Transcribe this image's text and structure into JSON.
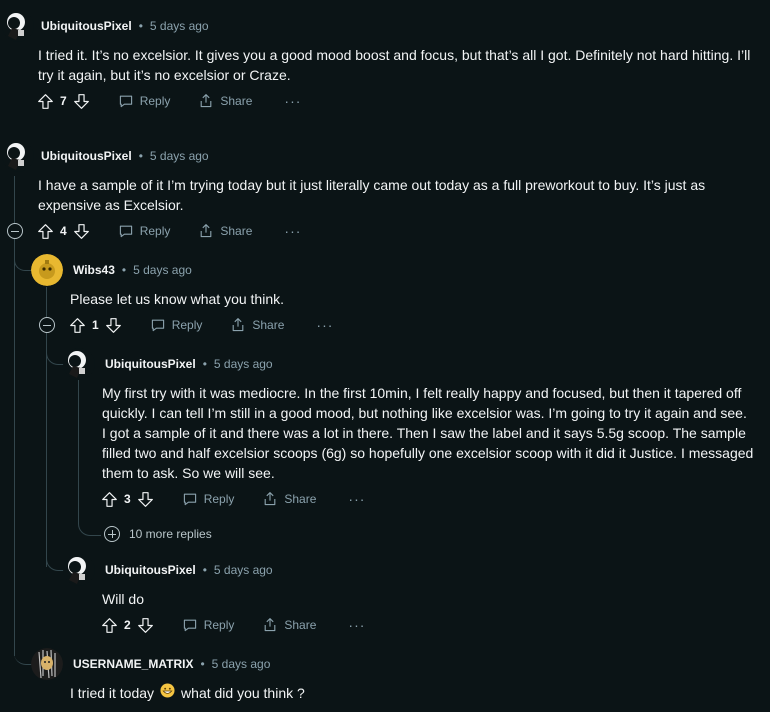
{
  "comments": [
    {
      "author": "UbiquitousPixel",
      "time": "5 days ago",
      "body": "I tried it. It’s no excelsior. It gives you a good mood boost and focus, but that’s all I got. Definitely not hard hitting. I’ll try it again, but it’s no excelsior or Craze.",
      "score": "7"
    },
    {
      "author": "UbiquitousPixel",
      "time": "5 days ago",
      "body": "I have a sample of it I’m trying today but it just literally came out today as a full preworkout to buy. It’s just as expensive as Excelsior.",
      "score": "4"
    },
    {
      "author": "Wibs43",
      "time": "5 days ago",
      "body": "Please let us know what you think.",
      "score": "1"
    },
    {
      "author": "UbiquitousPixel",
      "time": "5 days ago",
      "body": "My first try with it was mediocre. In the first 10min, I felt really happy and focused, but then it tapered off quickly. I can tell I’m still in a good mood, but nothing like excelsior was. I’m going to try it again and see. I got a sample of it and there was a lot in there. Then I saw the label and it says 5.5g scoop. The sample filled two and half excelsior scoops (6g) so hopefully one excelsior scoop with it did it Justice. I messaged them to ask. So we will see.",
      "score": "3"
    },
    {
      "author": "UbiquitousPixel",
      "time": "5 days ago",
      "body": "Will do",
      "score": "2"
    },
    {
      "author": "USERNAME_MATRIX",
      "time": "5 days ago",
      "body": "I tried it today",
      "body_after_emoji": "what did you think ?"
    }
  ],
  "labels": {
    "reply": "Reply",
    "share": "Share",
    "more": "···",
    "dot": "•",
    "more_replies": "10 more replies"
  },
  "colors": {
    "background": "#0b1416",
    "text": "#f2f4f5",
    "meta": "#8ba2ad",
    "thread_line": "#33464c"
  },
  "icons": {
    "upvote": "arrow-up-outline",
    "downvote": "arrow-down-outline",
    "reply": "speech-bubble",
    "share": "share-arrow",
    "collapse": "circle-minus",
    "expand": "circle-plus",
    "emoji": "grinning-face"
  }
}
